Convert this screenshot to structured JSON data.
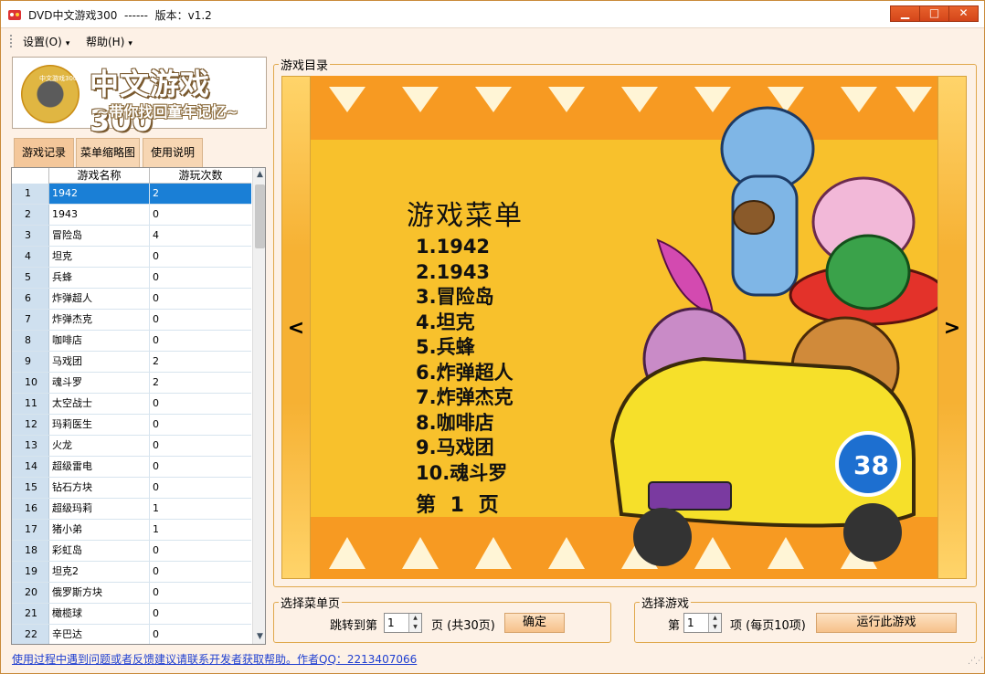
{
  "window": {
    "title": "DVD中文游戏300  ------  版本：v1.2",
    "minimize_label": "▁",
    "maximize_label": "□",
    "close_label": "✕"
  },
  "menubar": {
    "settings": "设置(O)",
    "help": "帮助(H)"
  },
  "logo": {
    "disc_label": "中文游戏300",
    "title": "中文游戏300",
    "subtitle": "~带你找回童年记忆~"
  },
  "tabs": [
    "游戏记录",
    "菜单缩略图",
    "使用说明"
  ],
  "grid": {
    "columns": [
      "游戏名称",
      "游玩次数"
    ],
    "rows": [
      {
        "no": "1",
        "name": "1942",
        "count": "2"
      },
      {
        "no": "2",
        "name": "1943",
        "count": "0"
      },
      {
        "no": "3",
        "name": "冒险岛",
        "count": "4"
      },
      {
        "no": "4",
        "name": "坦克",
        "count": "0"
      },
      {
        "no": "5",
        "name": "兵蜂",
        "count": "0"
      },
      {
        "no": "6",
        "name": "炸弹超人",
        "count": "0"
      },
      {
        "no": "7",
        "name": "炸弹杰克",
        "count": "0"
      },
      {
        "no": "8",
        "name": "咖啡店",
        "count": "0"
      },
      {
        "no": "9",
        "name": "马戏团",
        "count": "2"
      },
      {
        "no": "10",
        "name": "魂斗罗",
        "count": "2"
      },
      {
        "no": "11",
        "name": "太空战士",
        "count": "0"
      },
      {
        "no": "12",
        "name": "玛莉医生",
        "count": "0"
      },
      {
        "no": "13",
        "name": "火龙",
        "count": "0"
      },
      {
        "no": "14",
        "name": "超级雷电",
        "count": "0"
      },
      {
        "no": "15",
        "name": "钻石方块",
        "count": "0"
      },
      {
        "no": "16",
        "name": "超级玛莉",
        "count": "1"
      },
      {
        "no": "17",
        "name": "猪小弟",
        "count": "1"
      },
      {
        "no": "18",
        "name": "彩虹岛",
        "count": "0"
      },
      {
        "no": "19",
        "name": "坦克2",
        "count": "0"
      },
      {
        "no": "20",
        "name": "俄罗斯方块",
        "count": "0"
      },
      {
        "no": "21",
        "name": "橄榄球",
        "count": "0"
      },
      {
        "no": "22",
        "name": "辛巴达",
        "count": "0"
      }
    ]
  },
  "game_dir": {
    "legend": "游戏目录",
    "prev_label": "<",
    "next_label": ">",
    "menu_title": "游戏菜单",
    "menu_items": [
      "1.1942",
      "2.1943",
      "3.冒险岛",
      "4.坦克",
      "5.兵蜂",
      "6.炸弹超人",
      "7.炸弹杰克",
      "8.咖啡店",
      "9.马戏团",
      "10.魂斗罗"
    ],
    "page_text": "第 1 页"
  },
  "menu_page": {
    "legend": "选择菜单页",
    "jump_label": "跳转到第",
    "page_value": "1",
    "total_label": "页 (共30页)",
    "confirm_button": "确定"
  },
  "select_game": {
    "legend": "选择游戏",
    "prefix_label": "第",
    "item_value": "1",
    "suffix_label": "项 (每页10项)",
    "run_button": "运行此游戏"
  },
  "status": {
    "link_text": "使用过程中遇到问题或者反馈建议请联系开发者获取帮助。作者QQ：2213407066"
  },
  "colors": {
    "window_bg": "#fdf1e6",
    "selection": "#1a7fd6",
    "screen_yellow": "#f8c12c",
    "close_red": "#d4461a"
  }
}
